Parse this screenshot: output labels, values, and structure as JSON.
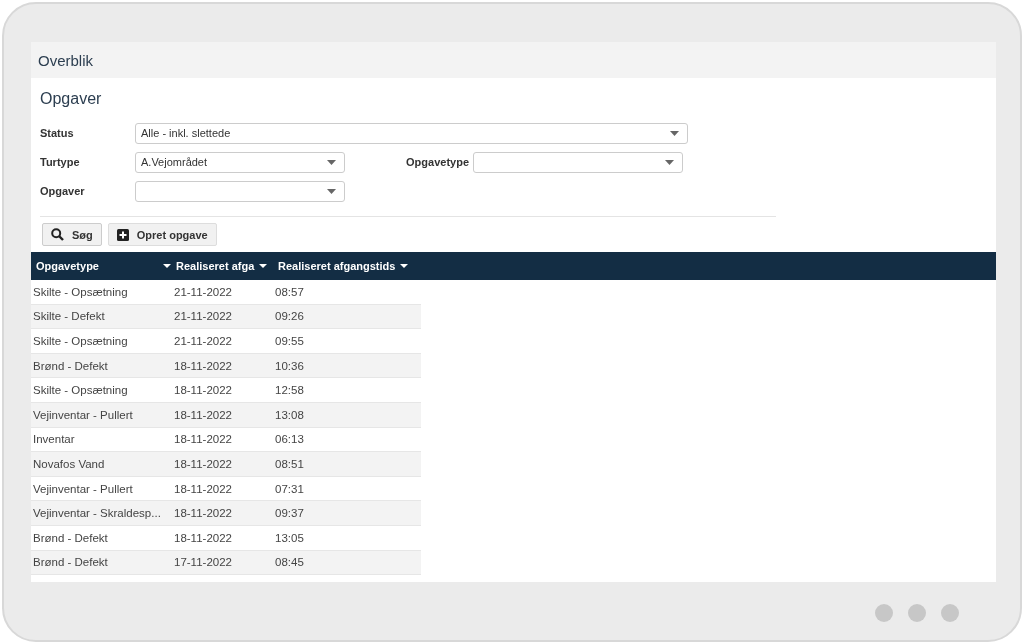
{
  "page_title": "Overblik",
  "section_title": "Opgaver",
  "filters": [
    {
      "label": "Status",
      "value": "Alle - inkl. slettede"
    },
    {
      "label": "Turtype",
      "value": "A.Vejområdet"
    },
    {
      "label": "Opgavetype"
    },
    {
      "label": "Opgaver"
    }
  ],
  "buttons": [
    {
      "label": "Søg",
      "kind": "search"
    },
    {
      "label": "Opret opgave",
      "kind": "add"
    }
  ],
  "table": {
    "columns": [
      "Opgavetype",
      "Realiseret afga",
      "Realiseret afgangstids"
    ],
    "rows": [
      [
        "Skilte - Opsætning",
        "21-11-2022",
        "08:57"
      ],
      [
        "Skilte - Defekt",
        "21-11-2022",
        "09:26"
      ],
      [
        "Skilte - Opsætning",
        "21-11-2022",
        "09:55"
      ],
      [
        "Brønd - Defekt",
        "18-11-2022",
        "10:36"
      ],
      [
        "Skilte - Opsætning",
        "18-11-2022",
        "12:58"
      ],
      [
        "Vejinventar - Pullert",
        "18-11-2022",
        "13:08"
      ],
      [
        "Inventar",
        "18-11-2022",
        "06:13"
      ],
      [
        "Novafos Vand",
        "18-11-2022",
        "08:51"
      ],
      [
        "Vejinventar - Pullert",
        "18-11-2022",
        "07:31"
      ],
      [
        "Vejinventar - Skraldesp...",
        "18-11-2022",
        "09:37"
      ],
      [
        "Brønd - Defekt",
        "18-11-2022",
        "13:05"
      ],
      [
        "Brønd - Defekt",
        "17-11-2022",
        "08:45"
      ]
    ]
  }
}
